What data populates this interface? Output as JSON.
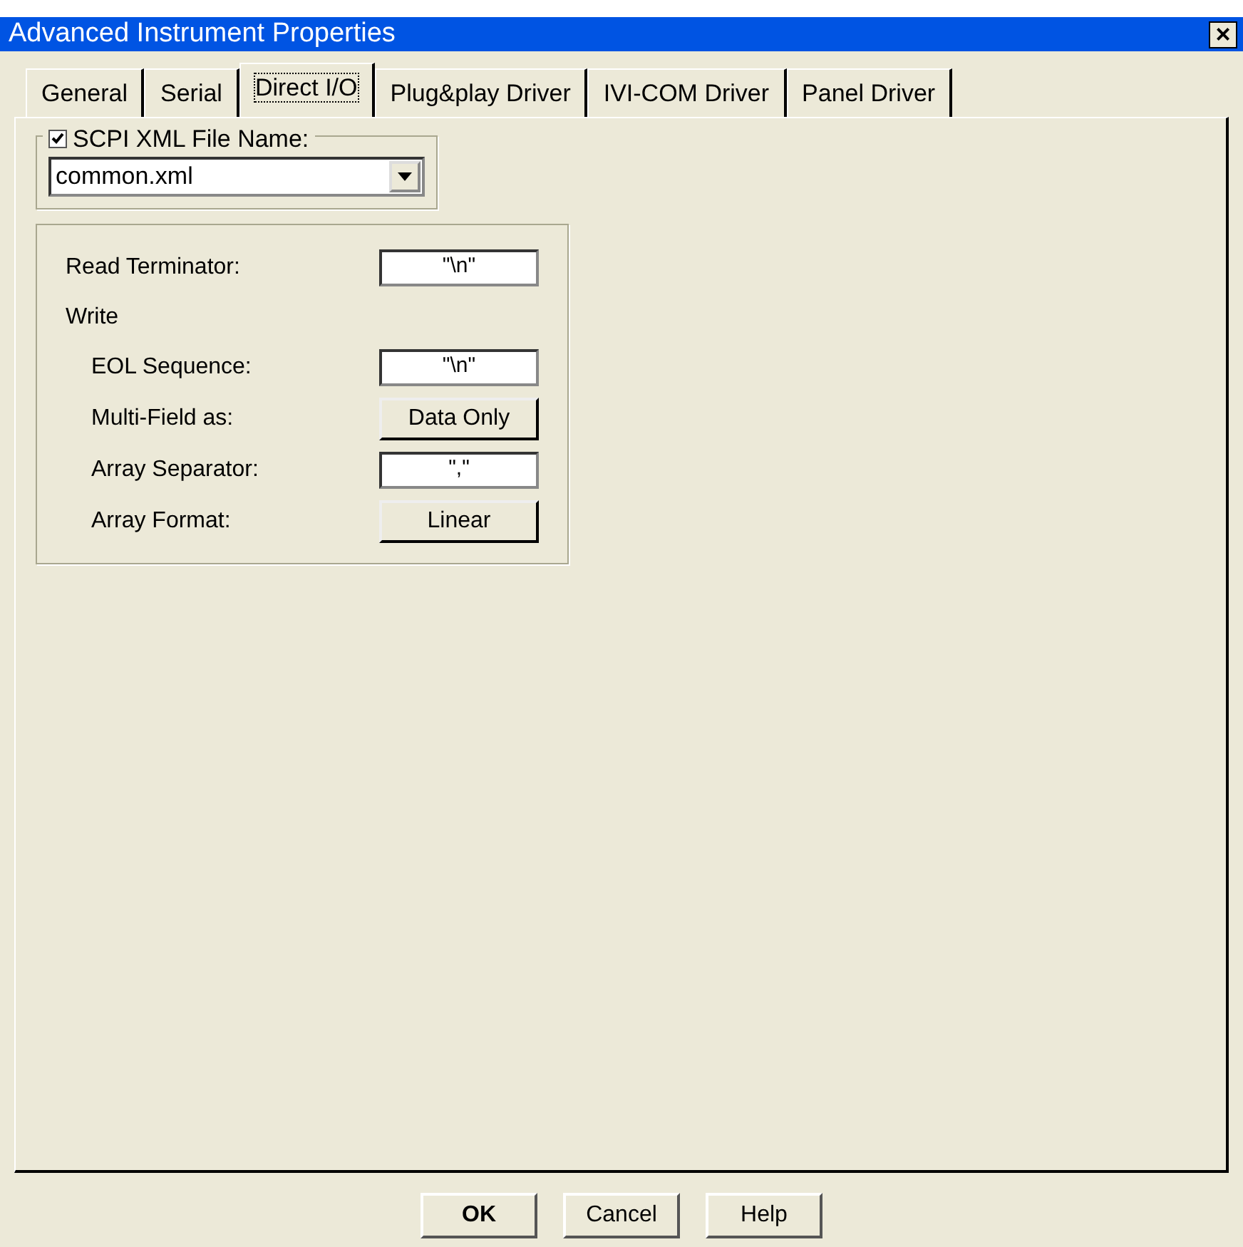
{
  "window": {
    "title": "Advanced Instrument Properties",
    "close": "×"
  },
  "tabs": [
    {
      "label": "General",
      "selected": false
    },
    {
      "label": "Serial",
      "selected": false
    },
    {
      "label": "Direct I/O",
      "selected": true
    },
    {
      "label": "Plug&play Driver",
      "selected": false
    },
    {
      "label": "IVI-COM Driver",
      "selected": false
    },
    {
      "label": "Panel Driver",
      "selected": false
    }
  ],
  "scpi_group": {
    "label": "SCPI XML File Name:",
    "checked": true,
    "dropdown": {
      "value": "common.xml"
    }
  },
  "settings": [
    {
      "kind": "field",
      "label": "Read Terminator:",
      "value": "\"\\n\""
    },
    {
      "kind": "group",
      "label": "Write",
      "children": [
        {
          "kind": "field",
          "label": "EOL Sequence:",
          "value": "\"\\n\""
        },
        {
          "kind": "button",
          "label": "Multi-Field as:",
          "value": "Data Only"
        },
        {
          "kind": "field",
          "label": "Array Separator:",
          "value": "\",\""
        },
        {
          "kind": "button",
          "label": "Array Format:",
          "value": "Linear"
        }
      ]
    }
  ],
  "buttons": [
    {
      "label": "OK",
      "default": true
    },
    {
      "label": "Cancel",
      "default": false
    },
    {
      "label": "Help",
      "default": false
    }
  ]
}
